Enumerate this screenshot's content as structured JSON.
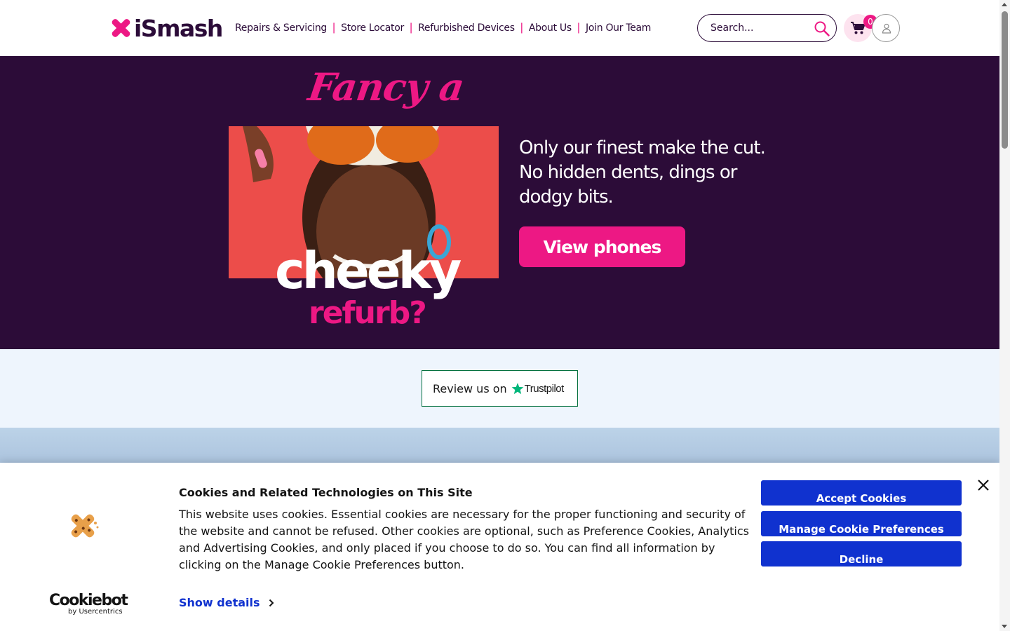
{
  "header": {
    "logo_text": "iSmash",
    "nav": [
      {
        "label": "Repairs & Servicing"
      },
      {
        "label": "Store Locator"
      },
      {
        "label": "Refurbished Devices"
      },
      {
        "label": "About Us"
      },
      {
        "label": "Join Our Team"
      }
    ],
    "nav_separator": "|",
    "search_placeholder": "Search...",
    "cart_count": "0"
  },
  "hero": {
    "script_heading": "Fancy a",
    "headline_main": "cheeky",
    "headline_sub": "refurb?",
    "text": "Only our finest make the cut. No hidden dents, dings or dodgy bits.",
    "cta_label": "View phones"
  },
  "trust": {
    "text": "Review us on",
    "brand": "Trustpilot"
  },
  "cookie_banner": {
    "title": "Cookies and Related Technologies on This Site",
    "body": "This website uses cookies. Essential cookies are necessary for the proper functioning and security of the website and cannot be refused. Other cookies are optional, such as Preference Cookies, Analytics and Advertising Cookies, and only placed if you choose to do so. You can find all information by clicking on the Manage Cookie Preferences button.",
    "show_details": "Show details",
    "accept_label": "Accept Cookies",
    "manage_label": "Manage Cookie Preferences",
    "decline_label": "Decline",
    "provider_name": "Cookiebot",
    "provider_sub": "by Usercentrics"
  },
  "colors": {
    "brand_pink": "#ed1884",
    "brand_purple": "#2c0c38",
    "cookie_button_blue": "#1032cf",
    "trustpilot_green": "#00b67a"
  },
  "icons": [
    "search-icon",
    "cart-icon",
    "user-icon",
    "close-icon",
    "chevron-right-icon",
    "cookie-icon",
    "trustpilot-star-icon"
  ]
}
